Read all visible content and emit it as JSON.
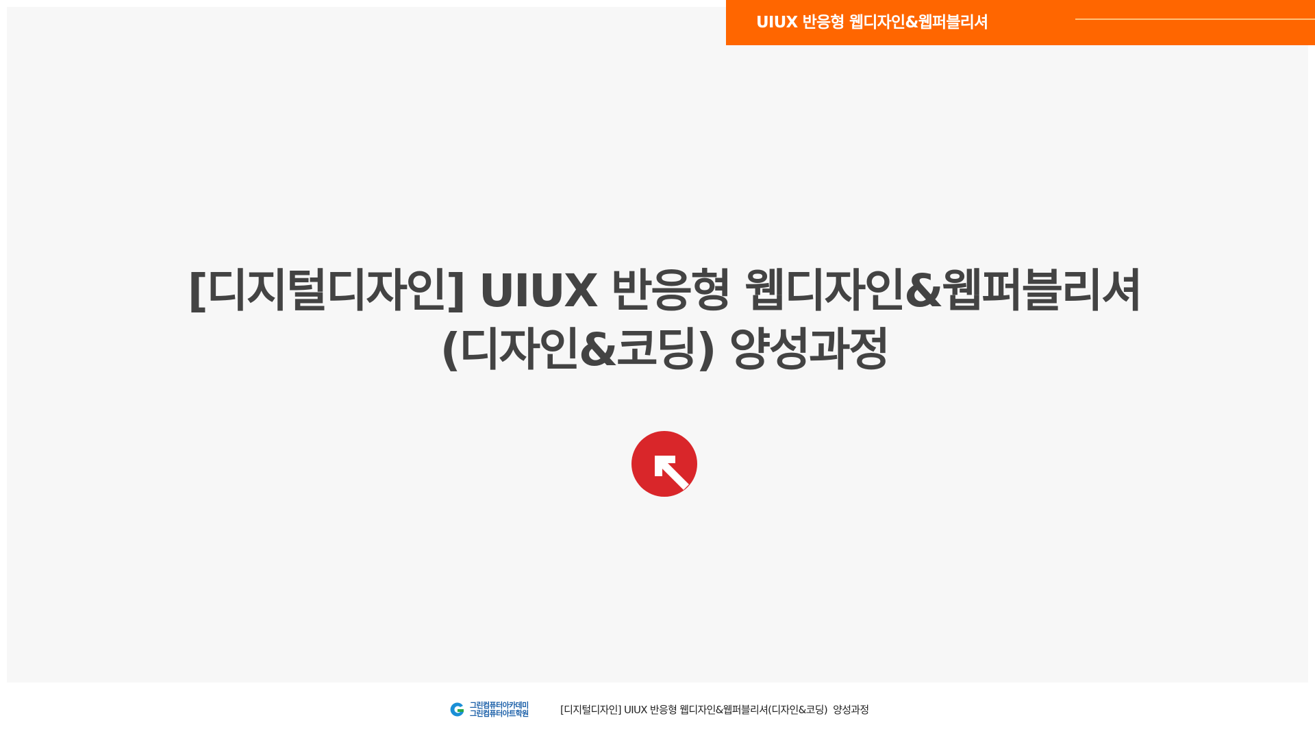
{
  "header": {
    "banner_title": "UIUX 반응형 웹디자인&웹퍼블리셔",
    "banner_color": "#ff6600"
  },
  "main": {
    "title_line1": "[디지털디자인] UIUX 반응형 웹디자인&웹퍼블리셔",
    "title_line2": "(디자인&코딩) 양성과정",
    "title_color": "#434343",
    "center_icon": "arrow-up-left-icon",
    "center_icon_color": "#d9262a"
  },
  "footer": {
    "logo_line1": "그린컴퓨터아카데미",
    "logo_line2": "그린컴퓨터아트학원",
    "logo_icon": "green-academy-g-icon",
    "course_text": "[디지털디자인] UIUX 반응형 웹디자인&웹퍼블리셔(디자인&코딩)  양성과정"
  }
}
